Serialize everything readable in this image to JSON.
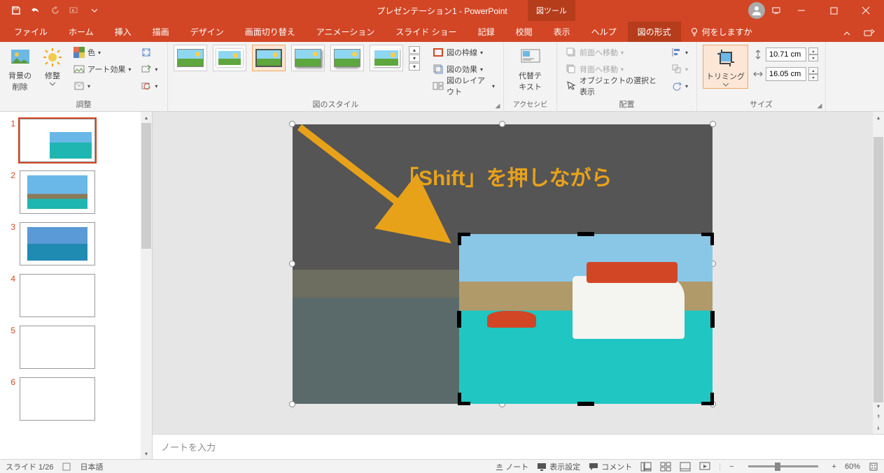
{
  "app": {
    "title": "プレゼンテーション1 - PowerPoint",
    "context_tab": "図ツール"
  },
  "tabs": {
    "file": "ファイル",
    "home": "ホーム",
    "insert": "挿入",
    "draw": "描画",
    "design": "デザイン",
    "transitions": "画面切り替え",
    "animations": "アニメーション",
    "slideshow": "スライド ショー",
    "record": "記録",
    "review": "校閲",
    "view": "表示",
    "help": "ヘルプ",
    "picformat": "図の形式",
    "tellme": "何をしますか"
  },
  "ribbon": {
    "adjust": {
      "label": "調整",
      "remove_bg": "背景の\n削除",
      "corrections": "修整",
      "color": "色",
      "artistic": "アート効果"
    },
    "styles": {
      "label": "図のスタイル",
      "border": "図の枠線",
      "effects": "図の効果",
      "layout": "図のレイアウト"
    },
    "accessibility": {
      "label": "アクセシビリティ",
      "alttext": "代替テ\nキスト"
    },
    "arrange": {
      "label": "配置",
      "forward": "前面へ移動",
      "backward": "背面へ移動",
      "selection": "オブジェクトの選択と表示"
    },
    "size": {
      "label": "サイズ",
      "crop": "トリミング",
      "height": "10.71 cm",
      "width": "16.05 cm"
    }
  },
  "slides": {
    "items": [
      1,
      2,
      3,
      4,
      5,
      6
    ]
  },
  "canvas": {
    "annotation": "「Shift」を押しながら"
  },
  "notes": {
    "placeholder": "ノートを入力"
  },
  "status": {
    "slide_info": "スライド 1/26",
    "language": "日本語",
    "notes": "ノート",
    "display": "表示設定",
    "comments": "コメント",
    "zoom": "60%"
  }
}
